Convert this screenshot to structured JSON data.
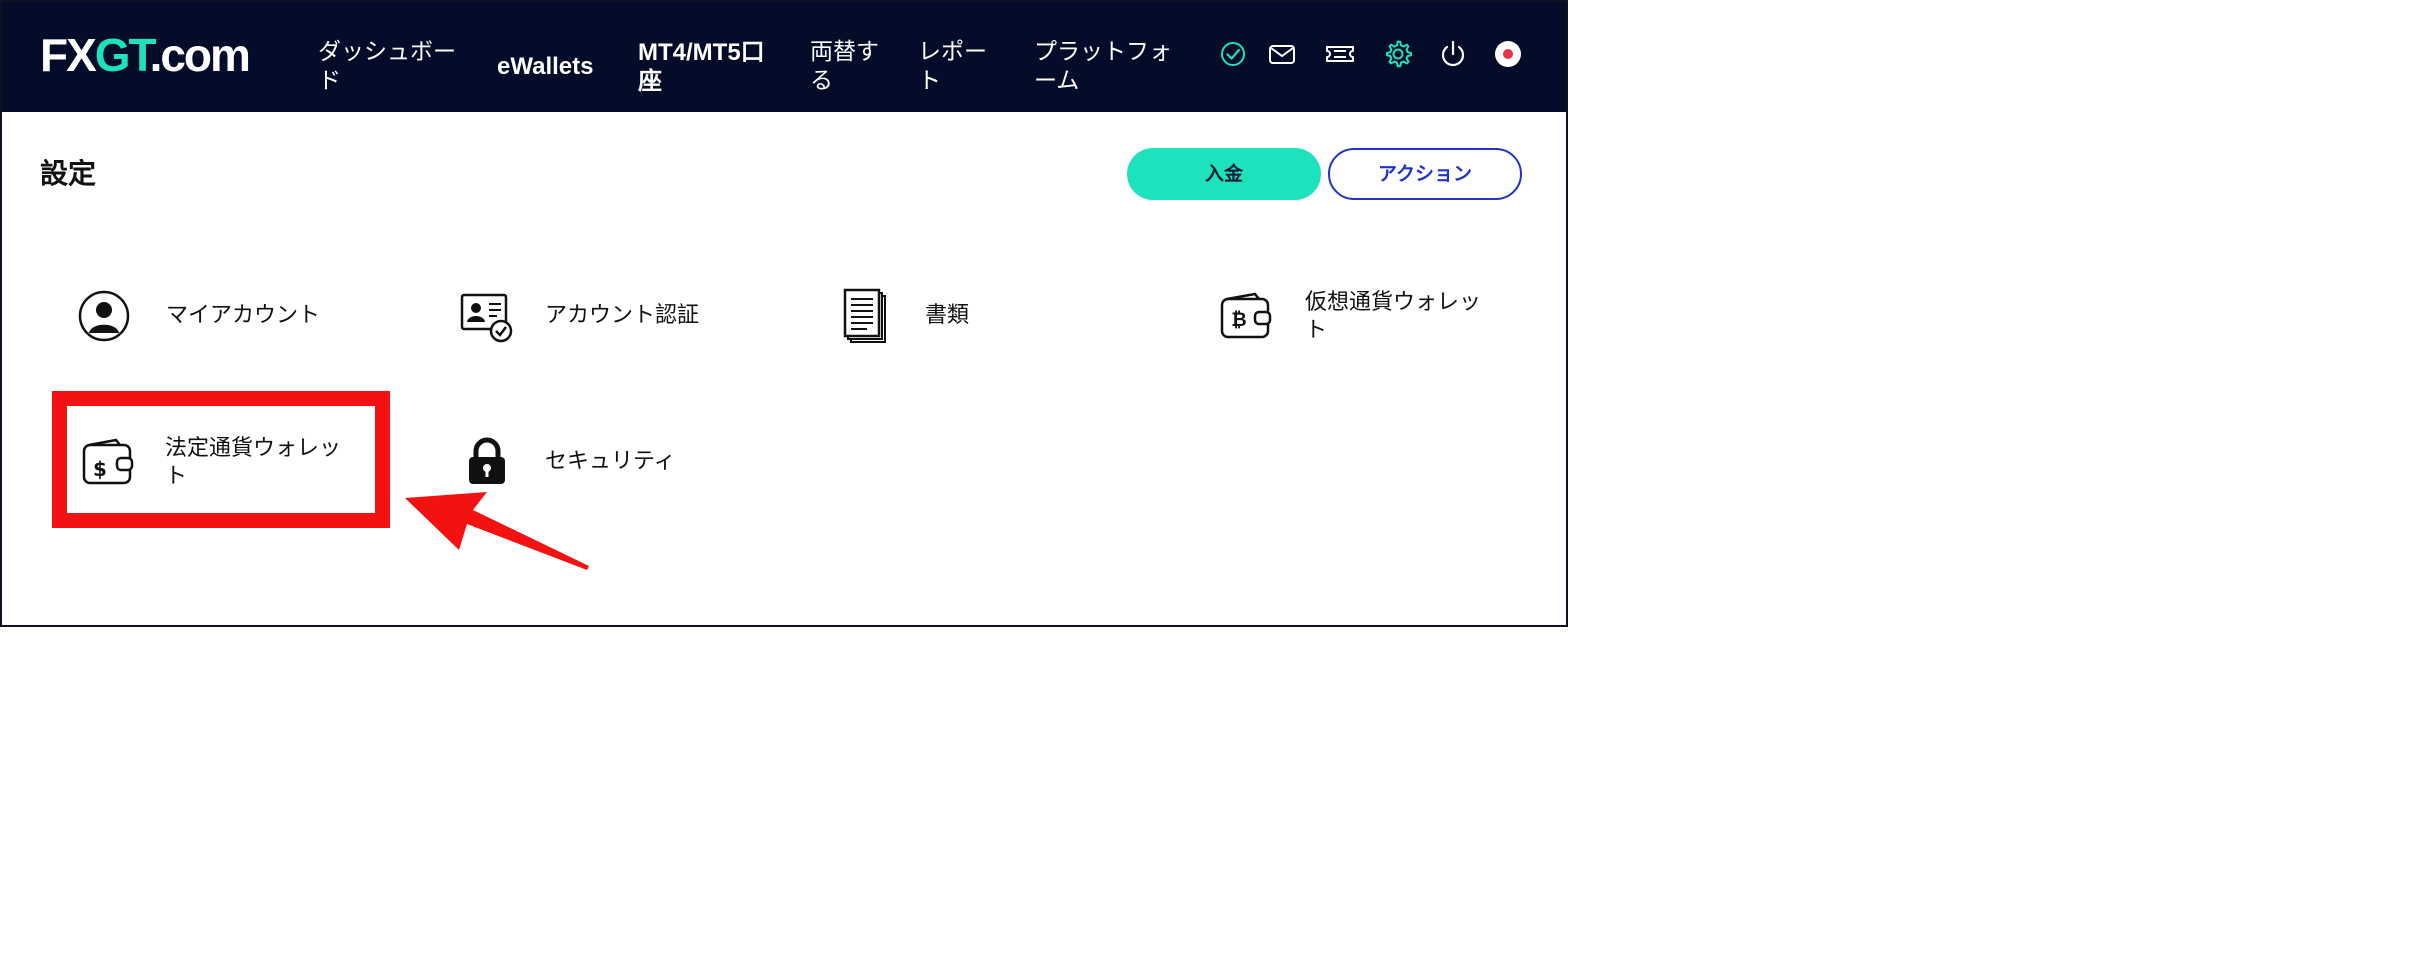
{
  "brand": {
    "logo_prefix": "FX",
    "logo_accent": "GT",
    "logo_suffix": ".com",
    "accent_color": "#1de2bb",
    "nav_bg_color": "#050c2a"
  },
  "nav": {
    "items": [
      {
        "label_line1": "ダッシュボー",
        "label_line2": "ド"
      },
      {
        "label_line1": "eWallets",
        "label_line2": ""
      },
      {
        "label_line1": "MT4/MT5口",
        "label_line2": "座"
      },
      {
        "label_line1": "両替す",
        "label_line2": "る"
      },
      {
        "label_line1": "レポー",
        "label_line2": "ト"
      },
      {
        "label_line1": "プラットフォ",
        "label_line2": "ーム"
      }
    ],
    "icons": [
      "verified-check-icon",
      "mail-icon",
      "ticket-icon",
      "gear-icon",
      "power-icon",
      "japan-flag-icon"
    ]
  },
  "page": {
    "title": "設定",
    "deposit_label": "入金",
    "action_label": "アクション"
  },
  "settings": {
    "tiles": [
      {
        "label_line1": "マイアカウント",
        "label_line2": "",
        "icon": "user-avatar-icon"
      },
      {
        "label_line1": "アカウント認証",
        "label_line2": "",
        "icon": "id-card-check-icon"
      },
      {
        "label_line1": "書類",
        "label_line2": "",
        "icon": "documents-icon"
      },
      {
        "label_line1": "仮想通貨ウォレッ",
        "label_line2": "ト",
        "icon": "crypto-wallet-icon"
      },
      {
        "label_line1": "法定通貨ウォレッ",
        "label_line2": "ト",
        "icon": "fiat-wallet-icon"
      },
      {
        "label_line1": "セキュリティ",
        "label_line2": "",
        "icon": "padlock-icon"
      }
    ]
  },
  "annotation": {
    "highlight_color": "#f21212",
    "highlighted_item": "法定通貨ウォレット"
  }
}
